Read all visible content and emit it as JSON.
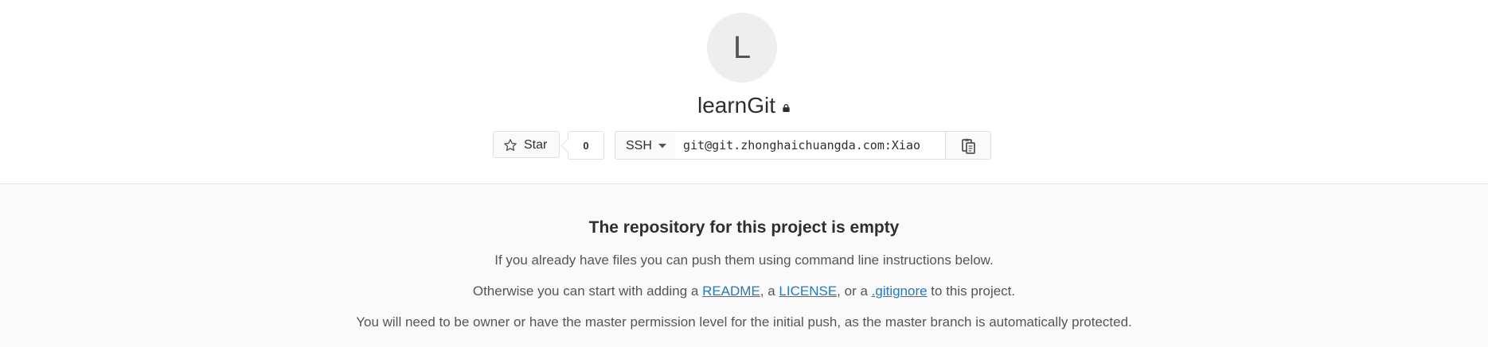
{
  "project": {
    "avatar_letter": "L",
    "name": "learnGit",
    "visibility_icon": "lock-icon"
  },
  "star": {
    "label": "Star",
    "count": "0",
    "icon": "star-icon"
  },
  "clone": {
    "protocol": "SSH",
    "url": "git@git.zhonghaichuangda.com:Xiao",
    "copy_icon": "clipboard-icon"
  },
  "empty_state": {
    "title": "The repository for this project is empty",
    "line1": "If you already have files you can push them using command line instructions below.",
    "line2_prefix": "Otherwise you can start with adding a ",
    "readme_link": "README",
    "sep1": ", a ",
    "license_link": "LICENSE",
    "sep2": ", or a ",
    "gitignore_link": ".gitignore",
    "line2_suffix": " to this project.",
    "line3": "You will need to be owner or have the master permission level for the initial push, as the master branch is automatically protected."
  },
  "colors": {
    "link": "#1f78d1",
    "avatar_bg": "#eeeeee",
    "empty_bg": "#fafafa"
  }
}
